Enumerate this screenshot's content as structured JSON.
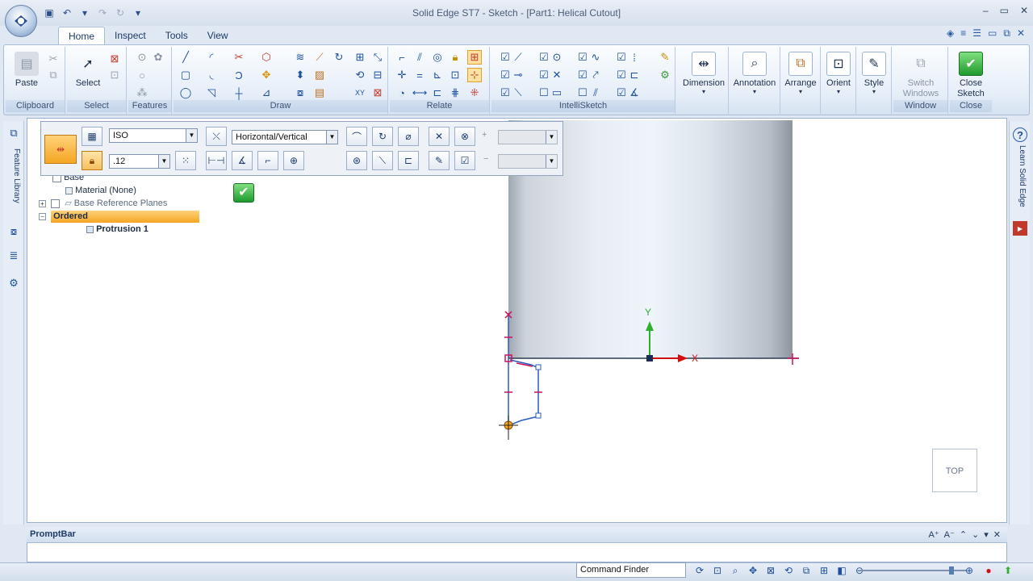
{
  "window": {
    "title": "Solid Edge ST7 - Sketch - [Part1: Helical Cutout]"
  },
  "tabs": [
    {
      "label": "Home",
      "active": true
    },
    {
      "label": "Inspect"
    },
    {
      "label": "Tools"
    },
    {
      "label": "View"
    }
  ],
  "ribbon": {
    "groups": {
      "clipboard": "Clipboard",
      "select": "Select",
      "features": "Features",
      "draw": "Draw",
      "relate": "Relate",
      "intellisketch": "IntelliSketch",
      "window": "Window",
      "close": "Close"
    },
    "buttons": {
      "paste": "Paste",
      "select": "Select",
      "dimension": "Dimension",
      "annotation": "Annotation",
      "arrange": "Arrange",
      "orient": "Orient",
      "style": "Style",
      "switch_windows": "Switch Windows",
      "close_sketch": "Close Sketch"
    }
  },
  "command_bar": {
    "standard": "ISO",
    "orientation": "Horizontal/Vertical",
    "value": ".12"
  },
  "side": {
    "feature_library": "Feature Library",
    "learn": "Learn Solid Edge"
  },
  "tree": [
    {
      "label": "Base"
    },
    {
      "label": "Material (None)"
    },
    {
      "label": "Base Reference Planes"
    },
    {
      "label": "Ordered"
    },
    {
      "label": "Protrusion 1"
    }
  ],
  "canvas": {
    "axis_x": "X",
    "axis_y": "Y",
    "view_cube": "TOP"
  },
  "promptbar": {
    "title": "PromptBar"
  },
  "status": {
    "command_finder": "Command Finder"
  },
  "colors": {
    "accent": "#f5a623",
    "ok_green": "#1f9a2e",
    "sketch_magenta": "#d0105a",
    "sketch_blue": "#2a5bc0"
  }
}
